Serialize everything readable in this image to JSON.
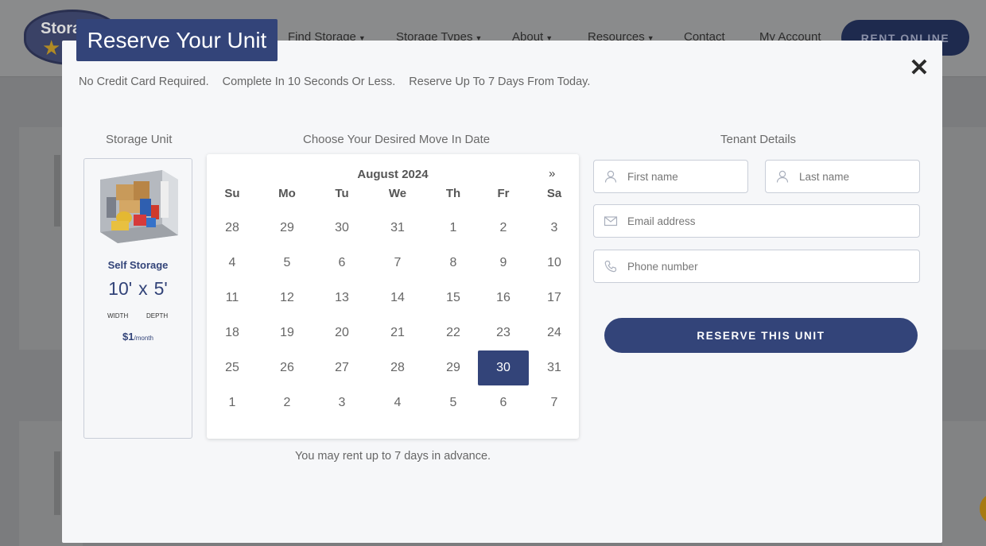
{
  "site": {
    "logo_text": "Stora",
    "nav": [
      {
        "label": "Find Storage",
        "caret": true
      },
      {
        "label": "Storage Types",
        "caret": true
      },
      {
        "label": "About",
        "caret": true
      },
      {
        "label": "Resources",
        "caret": true
      },
      {
        "label": "Contact",
        "caret": false
      },
      {
        "label": "My Account",
        "caret": false
      }
    ],
    "rent_online": "RENT ONLINE"
  },
  "modal": {
    "title": "Reserve Your Unit",
    "close_glyph": "✕",
    "subline": [
      "No Credit Card Required.",
      "Complete In 10 Seconds Or Less.",
      "Reserve Up To 7 Days From Today."
    ],
    "headings": {
      "storage_unit": "Storage Unit",
      "move_in": "Choose Your Desired Move In Date",
      "tenant": "Tenant Details"
    }
  },
  "unit": {
    "type": "Self Storage",
    "width": "10'",
    "x": "x",
    "depth": "5'",
    "width_label": "WIDTH",
    "depth_label": "DEPTH",
    "price": "$1",
    "price_unit": "/month"
  },
  "calendar": {
    "month_label": "August 2024",
    "next_glyph": "»",
    "weekdays": [
      "Su",
      "Mo",
      "Tu",
      "We",
      "Th",
      "Fr",
      "Sa"
    ],
    "weeks": [
      [
        "28",
        "29",
        "30",
        "31",
        "1",
        "2",
        "3"
      ],
      [
        "4",
        "5",
        "6",
        "7",
        "8",
        "9",
        "10"
      ],
      [
        "11",
        "12",
        "13",
        "14",
        "15",
        "16",
        "17"
      ],
      [
        "18",
        "19",
        "20",
        "21",
        "22",
        "23",
        "24"
      ],
      [
        "25",
        "26",
        "27",
        "28",
        "29",
        "30",
        "31"
      ],
      [
        "1",
        "2",
        "3",
        "4",
        "5",
        "6",
        "7"
      ]
    ],
    "selected": "30",
    "note": "You may rent up to 7 days in advance."
  },
  "tenant": {
    "first_name_placeholder": "First name",
    "last_name_placeholder": "Last name",
    "email_placeholder": "Email address",
    "phone_placeholder": "Phone number",
    "reserve_label": "RESERVE THIS UNIT"
  },
  "colors": {
    "primary": "#334479",
    "overlay": "#7b7c7e"
  }
}
